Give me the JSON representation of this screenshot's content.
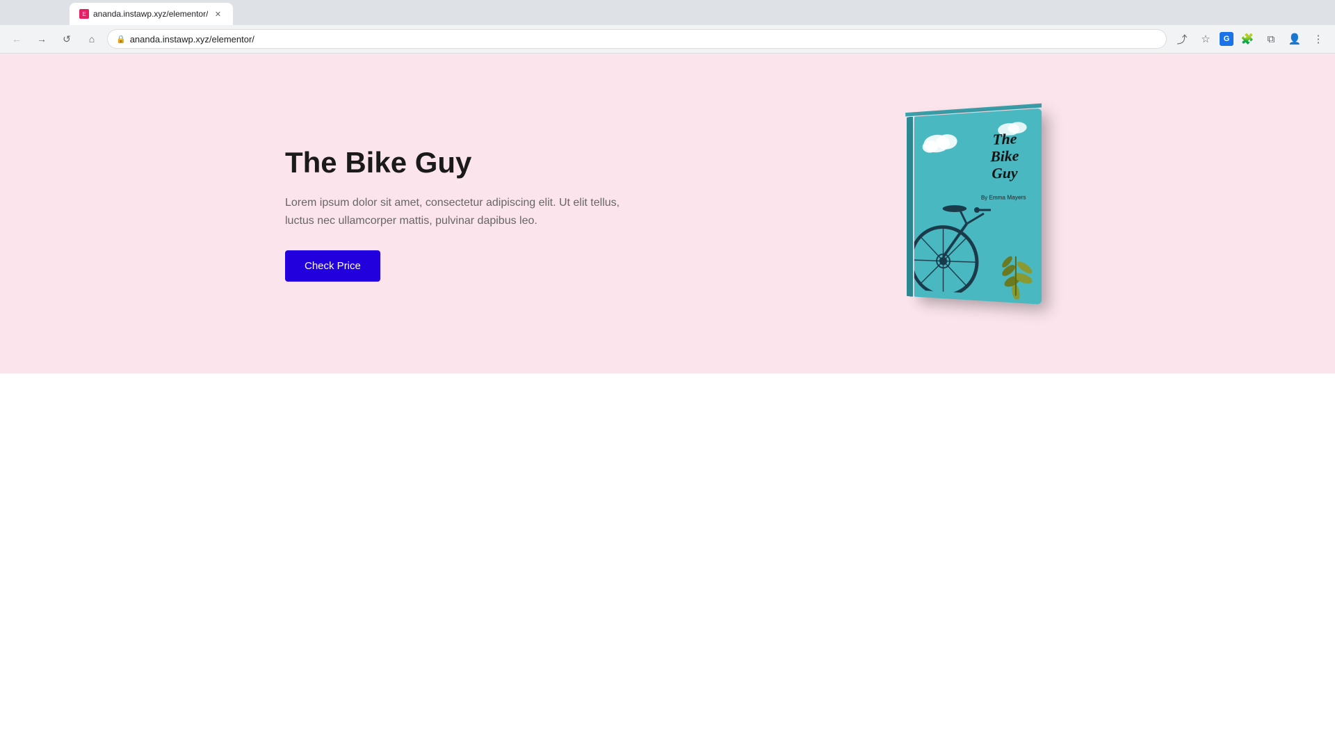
{
  "browser": {
    "url": "ananda.instawp.xyz/elementor/",
    "tab_title": "ananda.instawp.xyz/elementor/",
    "nav": {
      "back": "←",
      "forward": "→",
      "reload": "↺",
      "home": "⌂"
    },
    "toolbar_icons": [
      "share",
      "star",
      "extension",
      "puzzle",
      "window",
      "profile",
      "menu"
    ]
  },
  "hero": {
    "title": "The Bike Guy",
    "description": "Lorem ipsum dolor sit amet, consectetur adipiscing elit. Ut elit tellus, luctus nec ullamcorper mattis, pulvinar dapibus leo.",
    "cta_label": "Check Price",
    "book_title_line1": "The",
    "book_title_line2": "Bike",
    "book_title_line3": "Guy",
    "book_author": "By Emma Mayers",
    "background_color": "#fce4ec",
    "button_color": "#2200dd"
  }
}
